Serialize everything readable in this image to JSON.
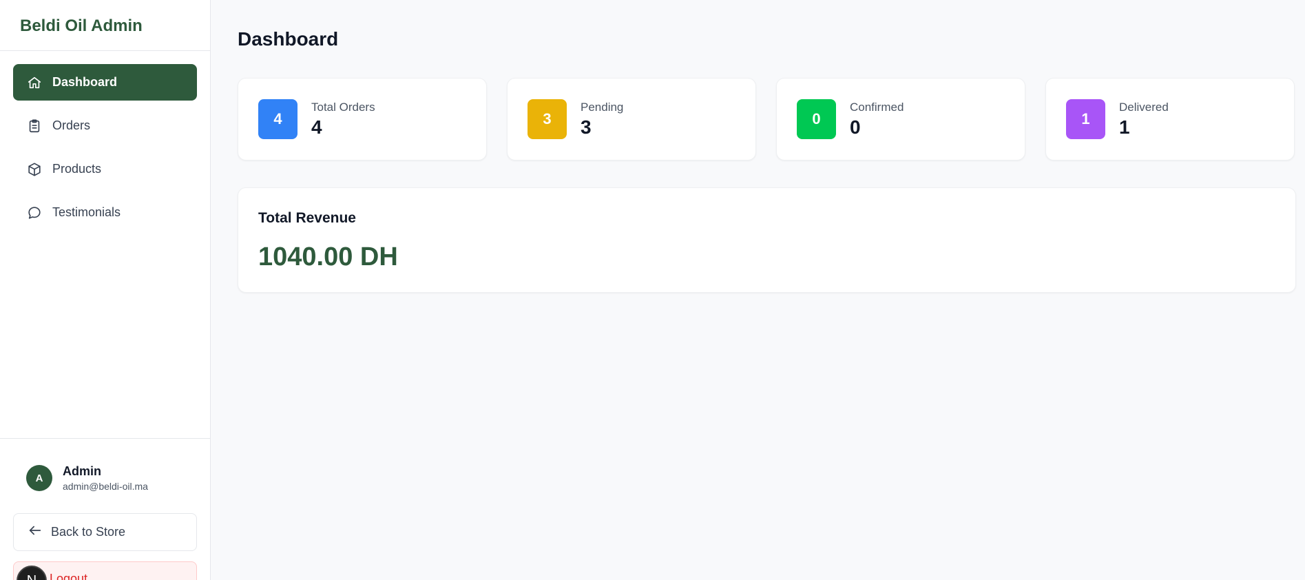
{
  "app": {
    "brand": "Beldi Oil Admin"
  },
  "sidebar": {
    "items": [
      {
        "label": "Dashboard",
        "icon": "home-icon",
        "active": true
      },
      {
        "label": "Orders",
        "icon": "clipboard-icon",
        "active": false
      },
      {
        "label": "Products",
        "icon": "box-icon",
        "active": false
      },
      {
        "label": "Testimonials",
        "icon": "chat-bubble-icon",
        "active": false
      }
    ]
  },
  "user": {
    "initial": "A",
    "name": "Admin",
    "email": "admin@beldi-oil.ma"
  },
  "footer": {
    "back_label": "Back to Store",
    "logout_label": "Logout",
    "badge_letter": "N"
  },
  "main": {
    "title": "Dashboard"
  },
  "stats": [
    {
      "icon_value": "4",
      "label": "Total Orders",
      "value": "4",
      "color": "#3182f6"
    },
    {
      "icon_value": "3",
      "label": "Pending",
      "value": "3",
      "color": "#eab308"
    },
    {
      "icon_value": "0",
      "label": "Confirmed",
      "value": "0",
      "color": "#00c853"
    },
    {
      "icon_value": "1",
      "label": "Delivered",
      "value": "1",
      "color": "#a855f7"
    }
  ],
  "revenue": {
    "title": "Total Revenue",
    "value": "1040.00 DH"
  },
  "colors": {
    "brand": "#2e5a3c",
    "logout": "#dc2626"
  }
}
